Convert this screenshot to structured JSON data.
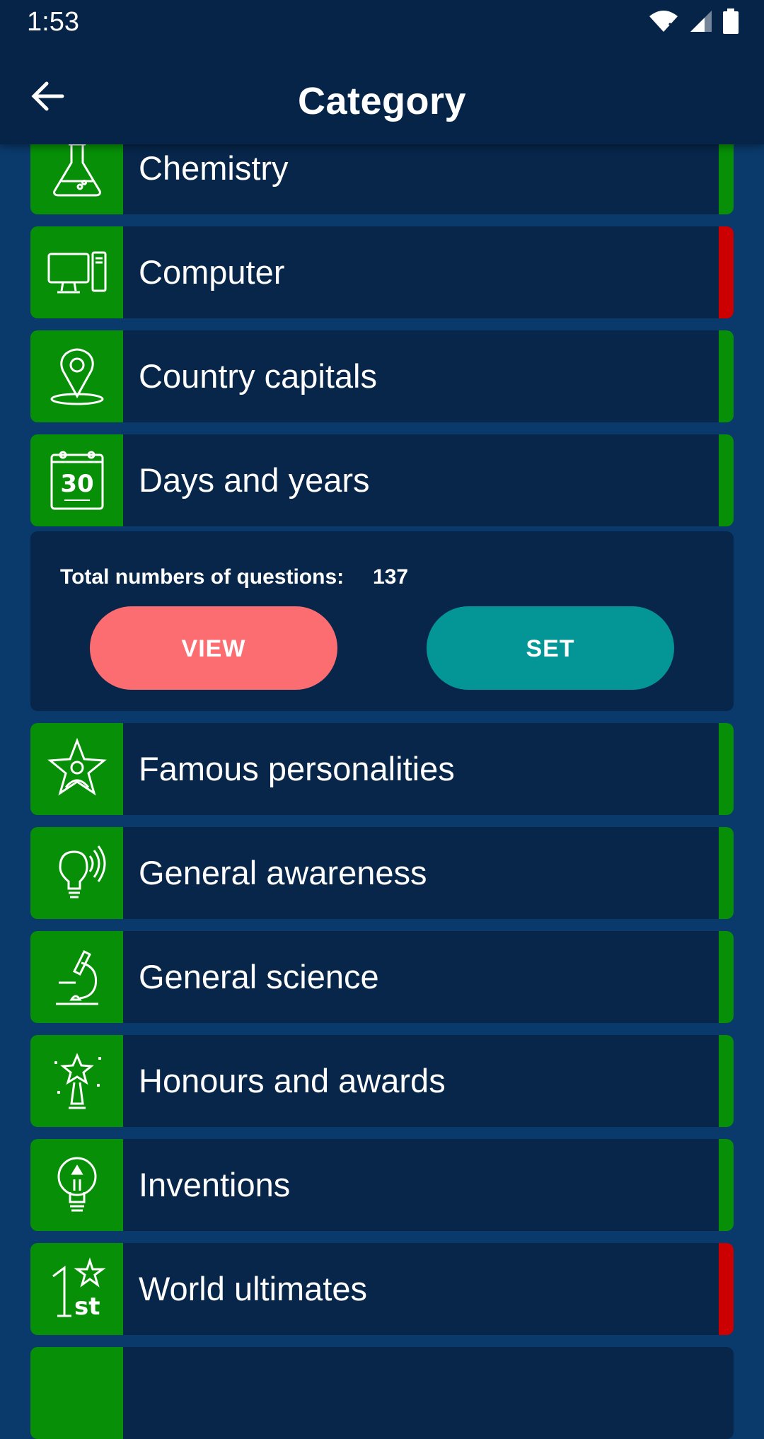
{
  "status_bar": {
    "time": "1:53"
  },
  "app_bar": {
    "title": "Category"
  },
  "categories": [
    {
      "label": "Chemistry",
      "icon": "flask-icon",
      "status_color": "#079007"
    },
    {
      "label": "Computer",
      "icon": "computer-icon",
      "status_color": "#cc0000"
    },
    {
      "label": "Country capitals",
      "icon": "map-pin-icon",
      "status_color": "#079007"
    },
    {
      "label": "Days and years",
      "icon": "calendar-icon",
      "status_color": "#079007"
    },
    {
      "label": "Famous personalities",
      "icon": "star-person-icon",
      "status_color": "#079007"
    },
    {
      "label": "General awareness",
      "icon": "bulb-signal-icon",
      "status_color": "#079007"
    },
    {
      "label": "General science",
      "icon": "microscope-icon",
      "status_color": "#079007"
    },
    {
      "label": "Honours and awards",
      "icon": "trophy-icon",
      "status_color": "#079007"
    },
    {
      "label": "Inventions",
      "icon": "lightbulb-icon",
      "status_color": "#079007"
    },
    {
      "label": "World ultimates",
      "icon": "first-place-icon",
      "status_color": "#cc0000"
    }
  ],
  "details_panel": {
    "total_label": "Total numbers of questions:",
    "total_value": "137",
    "view_label": "VIEW",
    "set_label": "SET"
  },
  "colors": {
    "background": "#0a3a6b",
    "app_bar": "#062447",
    "row_background": "#07264a",
    "icon_green": "#079007",
    "status_red": "#cc0000",
    "view_button": "#fc6d71",
    "set_button": "#049597"
  }
}
